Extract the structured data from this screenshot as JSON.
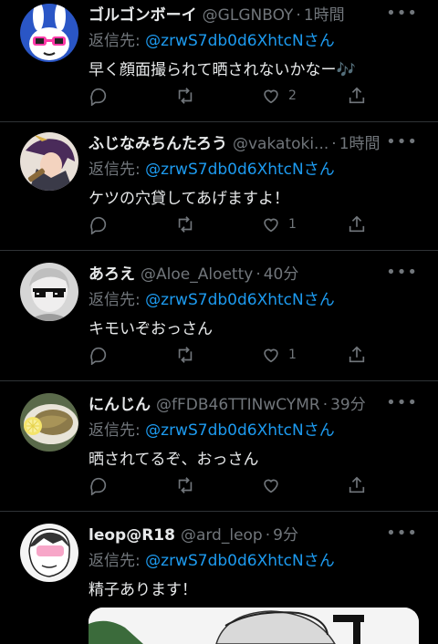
{
  "reply_prefix": "返信先: ",
  "more_glyph": "•••",
  "colors": {
    "link": "#1d9bf0",
    "muted": "#71767b",
    "text": "#e7e9ea",
    "divider": "#2f3336"
  },
  "tweets": [
    {
      "name": "ゴルゴンボーイ",
      "handle": "@GLGNBOY",
      "time": "1時間",
      "reply_to": "@zrwS7db0d6XhtcNさん",
      "text": "早く顔面撮られて晒されないかなー🎶",
      "likes": "2",
      "avatar_icon": "bunny-sunglasses-avatar"
    },
    {
      "name": "ふじなみちんたろう",
      "handle": "@vakatoki...",
      "time": "1時間",
      "reply_to": "@zrwS7db0d6XhtcNさん",
      "text": "ケツの穴貸してあげますよ！",
      "likes": "1",
      "avatar_icon": "anime-character-avatar"
    },
    {
      "name": "あろえ",
      "handle": "@Aloe_Aloetty",
      "time": "40分",
      "reply_to": "@zrwS7db0d6XhtcNさん",
      "text": "キモいぞおっさん",
      "likes": "1",
      "avatar_icon": "pixel-sunglasses-avatar"
    },
    {
      "name": "にんじん",
      "handle": "@fFDB46TTINwCYMR",
      "time": "39分",
      "reply_to": "@zrwS7db0d6XhtcNさん",
      "text": "晒されてるぞ、おっさん",
      "likes": "",
      "avatar_icon": "food-photo-avatar"
    },
    {
      "name": "leop@R18",
      "handle": "@ard_leop",
      "time": "9分",
      "reply_to": "@zrwS7db0d6XhtcNさん",
      "text": "精子あります！",
      "likes": "",
      "avatar_icon": "manga-face-avatar"
    }
  ]
}
